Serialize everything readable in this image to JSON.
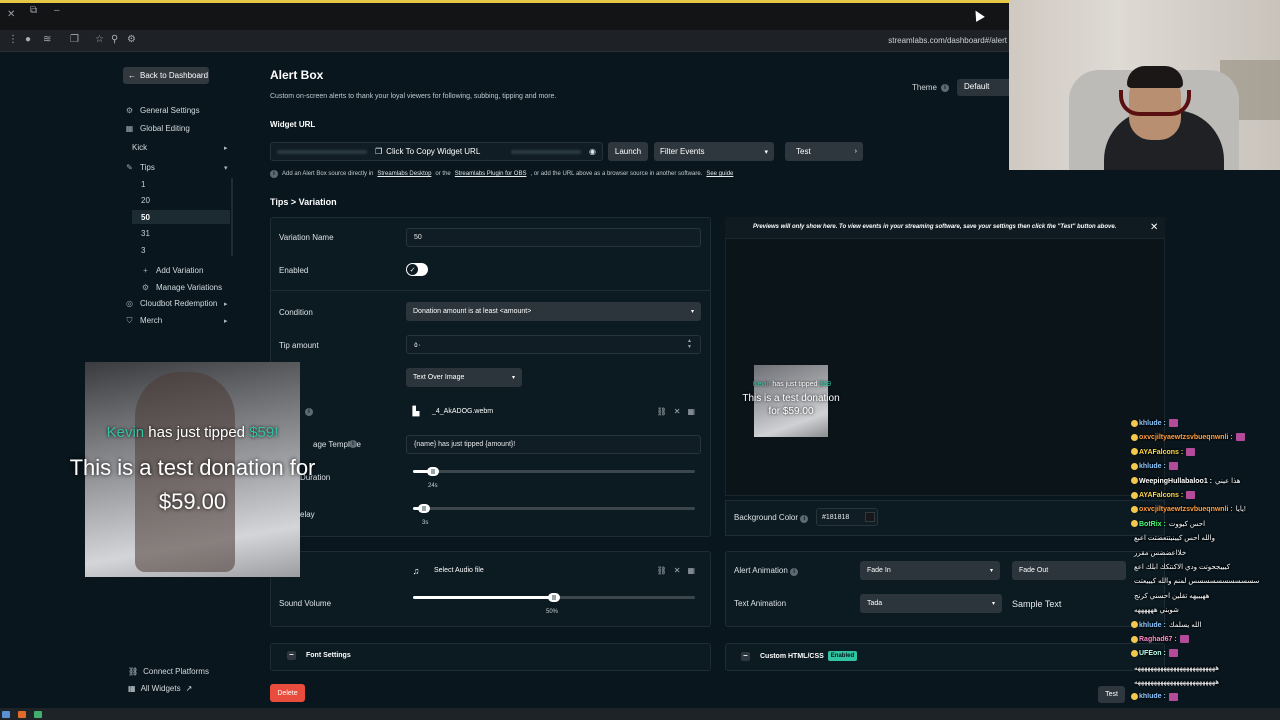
{
  "browser": {
    "url": "streamlabs.com/dashboard#/alert"
  },
  "sidebar": {
    "back_label": "Back to Dashboard",
    "items": [
      {
        "label": "General Settings",
        "icon": "gear-icon"
      },
      {
        "label": "Global Editing",
        "icon": "grid-icon"
      },
      {
        "label": "Kick",
        "icon": ""
      },
      {
        "label": "Tips",
        "icon": "tag-icon"
      }
    ],
    "tip_variations": [
      "1",
      "20",
      "50",
      "31",
      "3"
    ],
    "add_variation": "Add Variation",
    "manage_variations": "Manage Variations",
    "cloudbot": "Cloudbot Redemption",
    "merch": "Merch",
    "connect_platforms": "Connect Platforms",
    "all_widgets": "All Widgets"
  },
  "header": {
    "title": "Alert Box",
    "subtitle": "Custom on-screen alerts to thank your loyal viewers for following, subbing, tipping and more.",
    "theme_label": "Theme",
    "theme_value": "Default"
  },
  "widget": {
    "label": "Widget URL",
    "copy_label": "Click To Copy Widget URL",
    "launch": "Launch",
    "filter": "Filter Events",
    "test": "Test",
    "notice_pre": "Add an Alert Box source directly in",
    "notice_link1": "Streamlabs Desktop",
    "notice_mid": "or the",
    "notice_link2": "Streamlabs Plugin for OBS",
    "notice_post": ", or add the URL above as a browser source in another software.",
    "notice_link3": "See guide"
  },
  "breadcrumb": "Tips > Variation",
  "form": {
    "variation_name_label": "Variation Name",
    "variation_name_value": "50",
    "enabled_label": "Enabled",
    "enabled": true,
    "condition_label": "Condition",
    "condition_value": "Donation amount is at least <amount>",
    "tip_amount_label": "Tip amount",
    "tip_amount_value": "٥٠",
    "layout_value": "Text Over Image",
    "image_file": "_4_AkADOG.webm",
    "message_template_label": "age Template",
    "message_template_value": "{name} has just tipped {amount}!",
    "duration_label": "Duration",
    "duration_value": "24s",
    "duration_fraction": 0.07,
    "delay_label": "elay",
    "delay_value": "3s",
    "delay_fraction": 0.04,
    "audio_label": "Select Audio file",
    "sound_volume_label": "Sound Volume",
    "sound_volume_value": "50%",
    "sound_volume_fraction": 0.5,
    "font_settings": "Font Settings",
    "delete": "Delete"
  },
  "preview": {
    "header": "Previews will only show here. To view events in your streaming software, save your settings then click the \"Test\" button above.",
    "line1_name": "Kevin",
    "line1_mid": " has just tipped ",
    "line1_amount": "$59",
    "line2": "This is a test donation for $59.00",
    "bg_color_label": "Background Color",
    "bg_color_value": "#181818",
    "alert_animation_label": "Alert Animation",
    "fade_in": "Fade In",
    "fade_out": "Fade Out",
    "text_animation_label": "Text Animation",
    "text_animation_value": "Tada",
    "sample_text": "Sample Text",
    "custom_html": "Custom HTML/CSS",
    "enabled_badge": "Enabled",
    "test": "Test"
  },
  "overlay": {
    "line1_name": "Kevin",
    "line1_mid": " has just tipped ",
    "line1_amount": "$59!",
    "line2": "This is a test donation for $59.00"
  },
  "chat": [
    {
      "name": "khlude :",
      "cls": "n1"
    },
    {
      "name": "oxvcjiltyaewtzsvbueqnwnli :",
      "cls": "n2"
    },
    {
      "name": "AYAFalcons :",
      "cls": "n3"
    },
    {
      "name": "khlude :",
      "cls": "n1"
    },
    {
      "name": "WeepingHullabaloo1 :",
      "cls": "n4",
      "text": "هذا عيني"
    },
    {
      "name": "AYAFalcons :",
      "cls": "n3"
    },
    {
      "name": "oxvcjiltyaewtzsvbueqnwnli :",
      "cls": "n2",
      "text": "يايا!"
    },
    {
      "name": "BotRix :",
      "cls": "n5",
      "text": "احس كيووت"
    },
    {
      "name": "",
      "cls": "n4",
      "text": "والله احس كيينيتتعضتت اعبع"
    },
    {
      "name": "",
      "cls": "n4",
      "text": "خلااعضضس مقرر"
    },
    {
      "name": "",
      "cls": "n4",
      "text": "كيييجحوتت ودي الاكنتكك ابلك اعع"
    },
    {
      "name": "",
      "cls": "n4",
      "text": "سسسسسسسسسسس لمنم والله كيييعتت"
    },
    {
      "name": "",
      "cls": "n4",
      "text": "ههيييهه تقلين احسني كرنج"
    },
    {
      "name": "",
      "cls": "n4",
      "text": "شوبني ههههههه"
    },
    {
      "name": "khlude :",
      "cls": "n1",
      "text": "الله يسلمك"
    },
    {
      "name": "Raghad67 :",
      "cls": "n6"
    },
    {
      "name": "UFEon :",
      "cls": "n7"
    },
    {
      "name": "",
      "cls": "n4",
      "text": "هههههههههههههههههههههههههه"
    },
    {
      "name": "",
      "cls": "n4",
      "text": "هههههههههههههههههههههههههه"
    },
    {
      "name": "khlude :",
      "cls": "n1"
    }
  ]
}
